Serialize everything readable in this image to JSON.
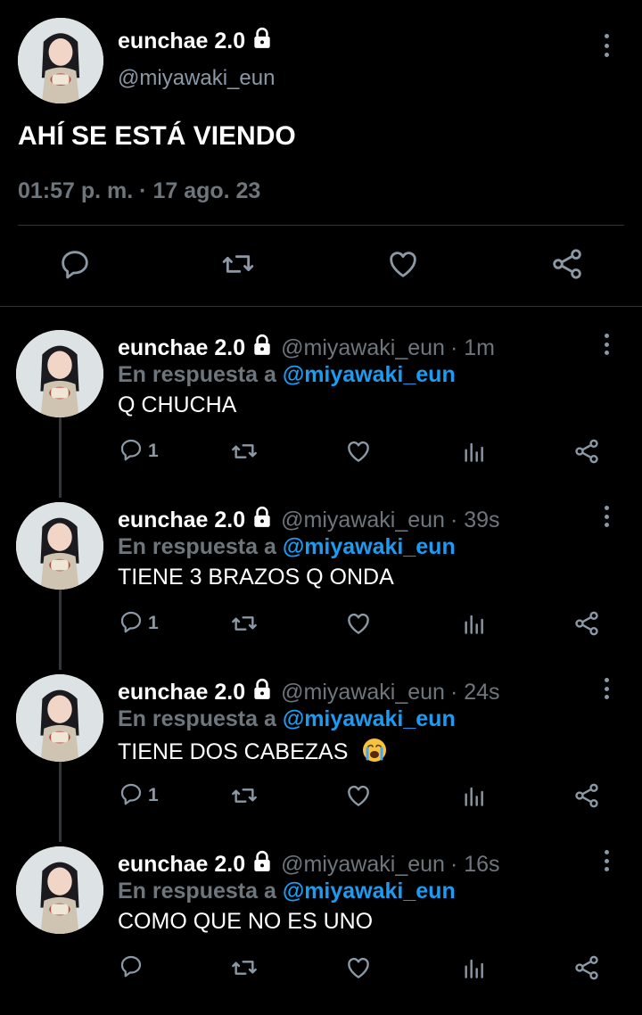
{
  "main_tweet": {
    "display_name": "eunchae 2.0",
    "handle": "@miyawaki_eun",
    "text": "AHÍ SE ESTÁ VIENDO",
    "timestamp": "01:57 p. m. · 17 ago. 23",
    "icons": [
      "lock-icon",
      "more-icon",
      "reply-icon",
      "retweet-icon",
      "like-icon",
      "share-icon"
    ]
  },
  "replies": [
    {
      "display_name": "eunchae 2.0",
      "handle": "@miyawaki_eun",
      "time": "· 1m",
      "reply_prefix": "En respuesta a",
      "reply_to": "@miyawaki_eun",
      "text": "Q CHUCHA",
      "reply_count": "1"
    },
    {
      "display_name": "eunchae 2.0",
      "handle": "@miyawaki_eun",
      "time": "· 39s",
      "reply_prefix": "En respuesta a",
      "reply_to": "@miyawaki_eun",
      "text": "TIENE 3 BRAZOS Q ONDA",
      "reply_count": "1"
    },
    {
      "display_name": "eunchae 2.0",
      "handle": "@miyawaki_eun",
      "time": "· 24s",
      "reply_prefix": "En respuesta a",
      "reply_to": "@miyawaki_eun",
      "text": "TIENE DOS CABEZAS",
      "emoji": "loudly-crying-face",
      "reply_count": "1"
    },
    {
      "display_name": "eunchae 2.0",
      "handle": "@miyawaki_eun",
      "time": "· 16s",
      "reply_prefix": "En respuesta a",
      "reply_to": "@miyawaki_eun",
      "text": "COMO QUE NO ES UNO",
      "reply_count": ""
    }
  ],
  "colors": {
    "background": "#000000",
    "text": "#e7e9ea",
    "muted": "#6e767d",
    "link": "#1d9bf0",
    "divider": "#2f3336"
  }
}
